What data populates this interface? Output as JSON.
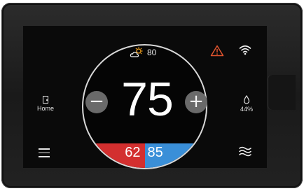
{
  "weather": {
    "outdoor_temp": "80",
    "icon": "partly-sunny-icon"
  },
  "setpoint": {
    "value": "75"
  },
  "controls": {
    "minus_label": "−",
    "plus_label": "+"
  },
  "modes": {
    "heat_setpoint": "62",
    "cool_setpoint": "85"
  },
  "left_panel": {
    "home_label": "Home",
    "menu_icon": "menu-icon"
  },
  "right_panel": {
    "humidity": "44%",
    "wifi_icon": "wifi-icon",
    "fan_icon": "fan-icon"
  },
  "status": {
    "alert_icon": "warning-icon"
  },
  "colors": {
    "heat": "#d32f2f",
    "cool": "#3a8fd8",
    "alert": "#e0542e"
  }
}
